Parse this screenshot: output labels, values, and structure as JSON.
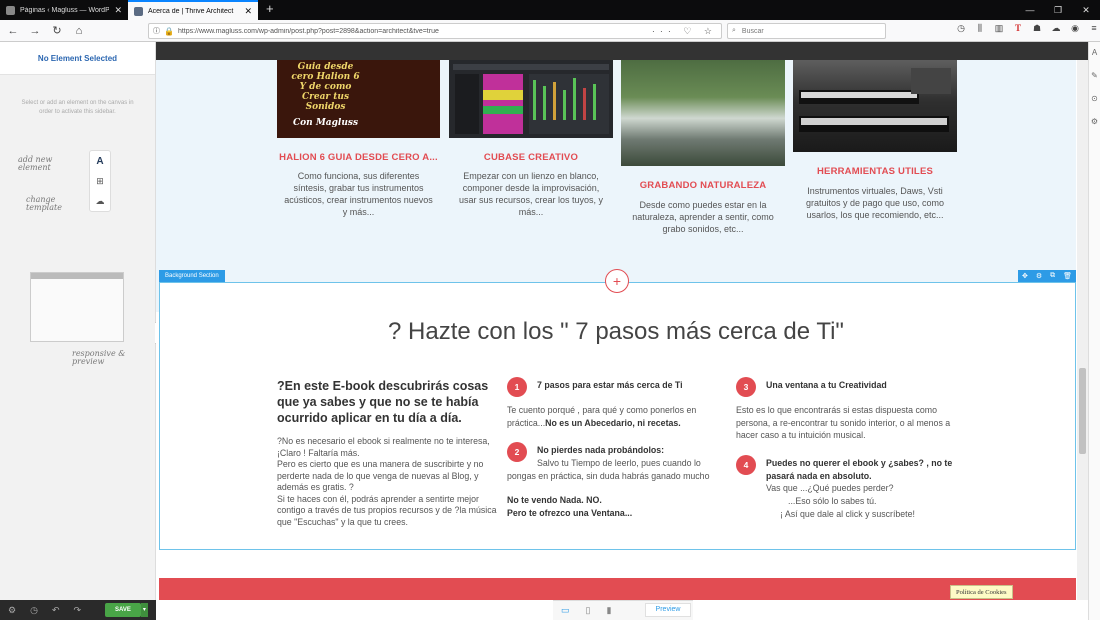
{
  "browser": {
    "tabs": [
      {
        "label": "Páginas ‹ Magluss — WordPress",
        "active": false
      },
      {
        "label": "Acerca de | Thrive Architect",
        "active": true
      }
    ],
    "close_glyph": "✕",
    "new_tab_glyph": "+",
    "url": "https://www.magluss.com/wp-admin/post.php?post=2898&action=architect&tve=true",
    "url_tail": "··· ♡ ☆",
    "search_placeholder": "Buscar",
    "window_controls": [
      "—",
      "❐",
      "✕"
    ]
  },
  "sidebar": {
    "title": "No Element Selected",
    "hint": "Select or add an element on the canvas in order to activate this sidebar.",
    "illus_add": "add new element",
    "illus_change": "change template",
    "illus_responsive": "responsive & preview",
    "save_label": "SAVE WORK"
  },
  "cards": [
    {
      "img_text": "Guia desde cero Halion 6 Y de como Crear tus Sonidos",
      "img_sub": "Con Magluss",
      "title": "HALION 6 GUIA DESDE CERO A...",
      "desc": "Como funciona,  sus diferentes síntesis, grabar tus instrumentos acústicos, crear instrumentos nuevos y más..."
    },
    {
      "title": "CUBASE CREATIVO",
      "desc": "Empezar con un lienzo en blanco, componer desde la improvisación, usar sus recursos, crear los tuyos, y más..."
    },
    {
      "title": "GRABANDO NATURALEZA",
      "desc": "Desde como puedes estar en la naturaleza, aprender a sentir,  como grabo sonidos, etc..."
    },
    {
      "title": "HERRAMIENTAS UTILES",
      "desc": "Instrumentos virtuales, Daws, Vsti gratuitos y de pago que uso, como usarlos, los que recomiendo, etc..."
    }
  ],
  "section": {
    "label": "Background Section",
    "plus": "+",
    "title": "? Hazte con los \" 7 pasos más cerca de Ti\"",
    "left_heading": "?En este E-book descubrirás cosas que ya sabes y que no se te había ocurrido aplicar en tu día a día.",
    "left_body": [
      "?No es necesario el ebook si realmente no te interesa, ¡Claro ! Faltaría más.",
      "Pero  es cierto que es una manera de suscribirte y no perderte nada de lo que venga de nuevas al Blog, y además es gratis. ?",
      "Si te haces con él, podrás aprender a sentirte mejor contigo a través de tus propios recursos y de ?la música que \"Escuchas\" y la que tu crees."
    ],
    "items": [
      {
        "num": "1",
        "title": "7 pasos para estar más cerca de Ti",
        "body": "Te cuento porqué , para qué y como ponerlos en práctica...",
        "bold": "No es un Abecedario, ni recetas."
      },
      {
        "num": "2",
        "title": "No pierdes nada probándolos:",
        "body": "Salvo tu Tiempo de leerlo, pues cuando lo pongas en práctica, sin duda habrás ganado mucho",
        "bold1": "No te vendo Nada. NO.",
        "bold2": "Pero te ofrezco una Ventana..."
      },
      {
        "num": "3",
        "title": "Una ventana a tu Creatividad",
        "body": "Esto es lo que encontrarás si estas dispuesta como persona, a re-encontrar tu sonido interior, o al menos a hacer caso a tu intuición musical."
      },
      {
        "num": "4",
        "title": "Puedes no querer el ebook y ¿sabes? , no te pasará nada en absoluto.",
        "l1": "Vas que ...¿Qué puedes perder?",
        "l2": "...Eso sólo lo sabes tú.",
        "l3": "¡ Así que dale al click y suscríbete!"
      }
    ]
  },
  "cookie_label": "Política de Cookies",
  "preview_label": "Preview",
  "colors": {
    "accent": "#e24c52",
    "primary_blue": "#2d9be6",
    "save_green": "#49a547"
  }
}
